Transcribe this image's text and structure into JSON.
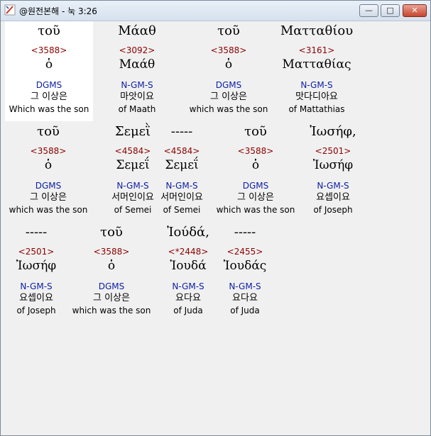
{
  "window": {
    "title": "@원전본해 - 눅 3:26",
    "minimize_label": "—",
    "maximize_label": "□",
    "close_label": "✕"
  },
  "words": [
    {
      "greek": "τοῦ",
      "number": "<3588>",
      "lemma": "ὁ",
      "parse": "DGMS",
      "korean": "그 이상은",
      "english": "Which was the son"
    },
    {
      "greek": "Μάαθ",
      "number": "<3092>",
      "lemma": "Μαάθ",
      "parse": "N-GM-S",
      "korean": "마앗이요",
      "english": "of Maath"
    },
    {
      "greek": "τοῦ",
      "number": "<3588>",
      "lemma": "ὁ",
      "parse": "DGMS",
      "korean": "그 이상은",
      "english": "which was the son"
    },
    {
      "greek": "Ματταθίου",
      "number": "<3161>",
      "lemma": "Ματταθίας",
      "parse": "N-GM-S",
      "korean": "맛다디아요",
      "english": "of Mattathias"
    },
    {
      "greek": "τοῦ",
      "number": "<3588>",
      "lemma": "ὁ",
      "parse": "DGMS",
      "korean": "그 이상은",
      "english": "which was the son"
    },
    {
      "greek": "Σεμεῒ",
      "number": "<4584>",
      "lemma": "Σεμεΐ",
      "parse": "N-GM-S",
      "korean": "서머인이요",
      "english": "of Semei"
    },
    {
      "greek": "-----",
      "number": "<4584>",
      "lemma": "Σεμεΐ",
      "parse": "N-GM-S",
      "korean": "서머인이요",
      "english": "of Semei"
    },
    {
      "greek": "τοῦ",
      "number": "<3588>",
      "lemma": "ὁ",
      "parse": "DGMS",
      "korean": "그 이상은",
      "english": "which was the son"
    },
    {
      "greek": "Ἰωσήφ,",
      "number": "<2501>",
      "lemma": "Ἰωσήφ",
      "parse": "N-GM-S",
      "korean": "요셉이요",
      "english": "of Joseph"
    },
    {
      "greek": "-----",
      "number": "<2501>",
      "lemma": "Ἰωσήφ",
      "parse": "N-GM-S",
      "korean": "요셉이요",
      "english": "of Joseph"
    },
    {
      "greek": "τοῦ",
      "number": "<3588>",
      "lemma": "ὁ",
      "parse": "DGMS",
      "korean": "그 이상은",
      "english": "which was the son"
    },
    {
      "greek": "Ἰούδά,",
      "number": "<*2448>",
      "lemma": "Ἰουδά",
      "parse": "N-GM-S",
      "korean": "요다요",
      "english": "of Juda"
    },
    {
      "greek": "-----",
      "number": "<2455>",
      "lemma": "Ἰουδάς",
      "parse": "N-GM-S",
      "korean": "요다요",
      "english": "of Juda"
    }
  ]
}
